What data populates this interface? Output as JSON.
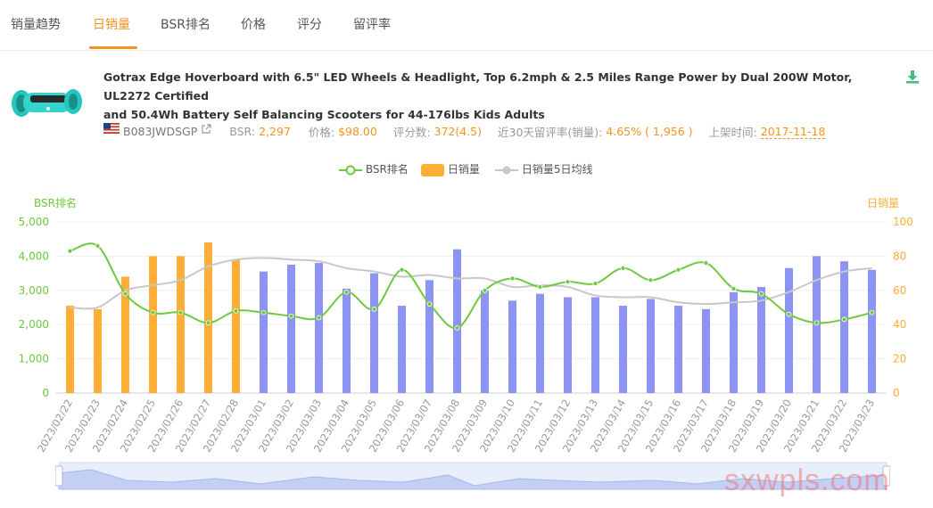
{
  "tabs": [
    {
      "label": "销量趋势",
      "active": false
    },
    {
      "label": "日销量",
      "active": true
    },
    {
      "label": "BSR排名",
      "active": false
    },
    {
      "label": "价格",
      "active": false
    },
    {
      "label": "评分",
      "active": false
    },
    {
      "label": "留评率",
      "active": false
    }
  ],
  "product": {
    "title_line1": "Gotrax Edge Hoverboard with 6.5\" LED Wheels & Headlight, Top 6.2mph & 2.5 Miles Range Power by Dual 200W Motor, UL2272 Certified",
    "title_line2": "and 50.4Wh Battery Self Balancing Scooters for 44-176lbs Kids Adults",
    "asin": "B083JWDSGP",
    "bsr_label": "BSR:",
    "bsr": "2,297",
    "price_label": "价格:",
    "price": "$98.00",
    "reviews_label": "评分数:",
    "reviews": "372(4.5)",
    "review_rate_label": "近30天留评率(销量):",
    "review_rate": "4.65% ( 1,956 )",
    "listed_label": "上架时间:",
    "listed": "2017-11-18",
    "icons": [
      "us-flag-icon",
      "external-link-icon",
      "download-icon"
    ]
  },
  "watermark": "sxwpls.com",
  "chart_data": {
    "type": "bar",
    "legend": [
      "BSR排名",
      "日销量",
      "日销量5日均线"
    ],
    "left_axis_title": "BSR排名",
    "right_axis_title": "日销量",
    "left_ticks": [
      "0",
      "1,000",
      "2,000",
      "3,000",
      "4,000",
      "5,000"
    ],
    "right_ticks": [
      "0",
      "20",
      "40",
      "60",
      "80",
      "100"
    ],
    "ylim_left": [
      0,
      5000
    ],
    "ylim_right": [
      0,
      100
    ],
    "categories": [
      "2023/02/22",
      "2023/02/23",
      "2023/02/24",
      "2023/02/25",
      "2023/02/26",
      "2023/02/27",
      "2023/02/28",
      "2023/03/01",
      "2023/03/02",
      "2023/03/03",
      "2023/03/04",
      "2023/03/05",
      "2023/03/06",
      "2023/03/07",
      "2023/03/08",
      "2023/03/09",
      "2023/03/10",
      "2023/03/11",
      "2023/03/12",
      "2023/03/13",
      "2023/03/14",
      "2023/03/15",
      "2023/03/16",
      "2023/03/17",
      "2023/03/18",
      "2023/03/19",
      "2023/03/20",
      "2023/03/21",
      "2023/03/22",
      "2023/03/23"
    ],
    "series": [
      {
        "name": "日销量",
        "axis": "right",
        "values": [
          51,
          49,
          68,
          80,
          80,
          88,
          78,
          71,
          75,
          76,
          61,
          70,
          51,
          66,
          84,
          60,
          54,
          58,
          56,
          56,
          51,
          55,
          51,
          49,
          59,
          62,
          73,
          80,
          77,
          72
        ]
      },
      {
        "name": "BSR排名",
        "axis": "left",
        "values": [
          4150,
          4300,
          2900,
          2350,
          2350,
          2050,
          2400,
          2350,
          2250,
          2200,
          2950,
          2450,
          3600,
          2600,
          1900,
          3000,
          3350,
          3100,
          3250,
          3200,
          3650,
          3300,
          3600,
          3800,
          3050,
          2900,
          2300,
          2050,
          2150,
          2350
        ]
      },
      {
        "name": "日销量5日均线",
        "axis": "right",
        "values": [
          50,
          50,
          60,
          63,
          66,
          74,
          78,
          79,
          78,
          77,
          73,
          71,
          68,
          69,
          67,
          67,
          62,
          63,
          62,
          57,
          56,
          56,
          53,
          52,
          53,
          54,
          59,
          66,
          71,
          73
        ]
      }
    ],
    "colors": {
      "bar_past": "#fdae36",
      "bar_current": "#8c93f2",
      "bsr_line": "#6ec93f",
      "ma_line": "#c8c8c8",
      "orange_count": 7
    }
  }
}
